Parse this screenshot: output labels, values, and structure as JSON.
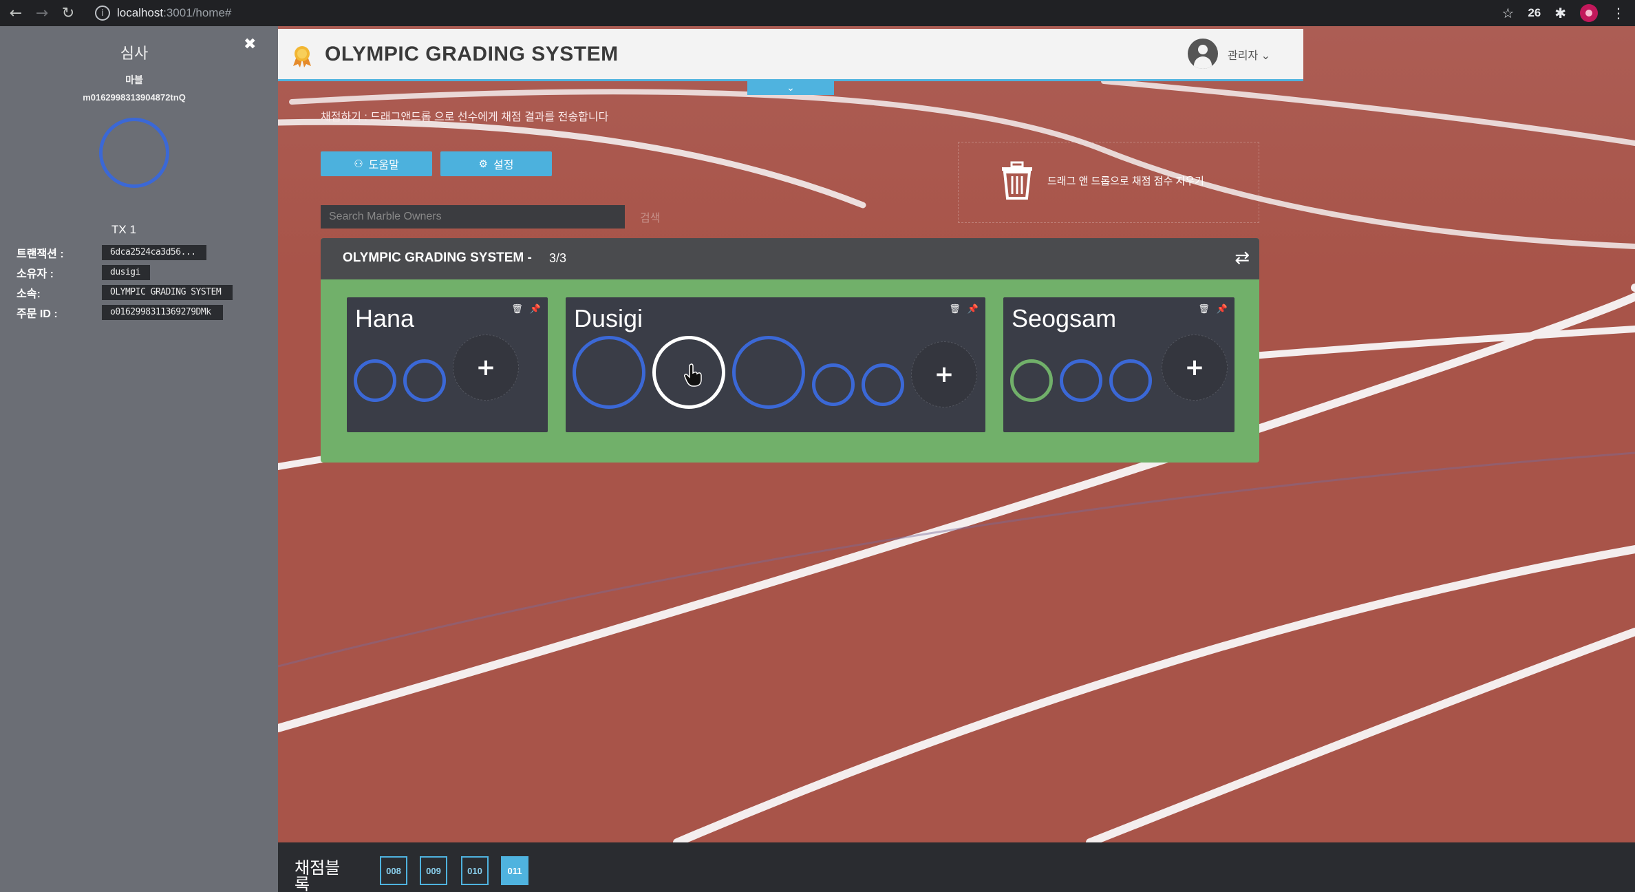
{
  "browser": {
    "url_host": "localhost",
    "url_path": ":3001/home#",
    "extension_count": "26"
  },
  "sidebar": {
    "title": "심사",
    "subtitle": "마블",
    "marble_id": "m0162998313904872tnQ",
    "tx_label": "TX 1",
    "fields": [
      {
        "label": "트랜잭션 :",
        "value": "6dca2524ca3d56..."
      },
      {
        "label": "소유자 :",
        "value": "dusigi"
      },
      {
        "label": "소속:",
        "value": "OLYMPIC GRADING SYSTEM"
      },
      {
        "label": "주문 ID :",
        "value": "o0162998311369279DMk"
      }
    ]
  },
  "header": {
    "title": "OLYMPIC GRADING SYSTEM",
    "user": "관리자"
  },
  "instruction": "채점하기 : 드래그앤드롭 으로 선수에게 채점 결과를 전송합니다",
  "buttons": {
    "help": "도움말",
    "settings": "설정"
  },
  "trash": {
    "label": "드래그 앤 드롭으로 채점 점수 지우기"
  },
  "search": {
    "placeholder": "Search Marble Owners",
    "go_label": "검색"
  },
  "panel": {
    "title": "OLYMPIC GRADING SYSTEM -",
    "count": "3/3"
  },
  "cards": [
    {
      "name": "Hana"
    },
    {
      "name": "Dusigi"
    },
    {
      "name": "Seogsam"
    }
  ],
  "footer": {
    "label": "채점블록",
    "pages": [
      "008",
      "009",
      "010",
      "011"
    ],
    "active_page": "011"
  },
  "colors": {
    "accent": "#4fb3df",
    "marble_blue": "#3b68d6",
    "marble_green": "#71b06a",
    "panel_green": "#71b06a"
  }
}
